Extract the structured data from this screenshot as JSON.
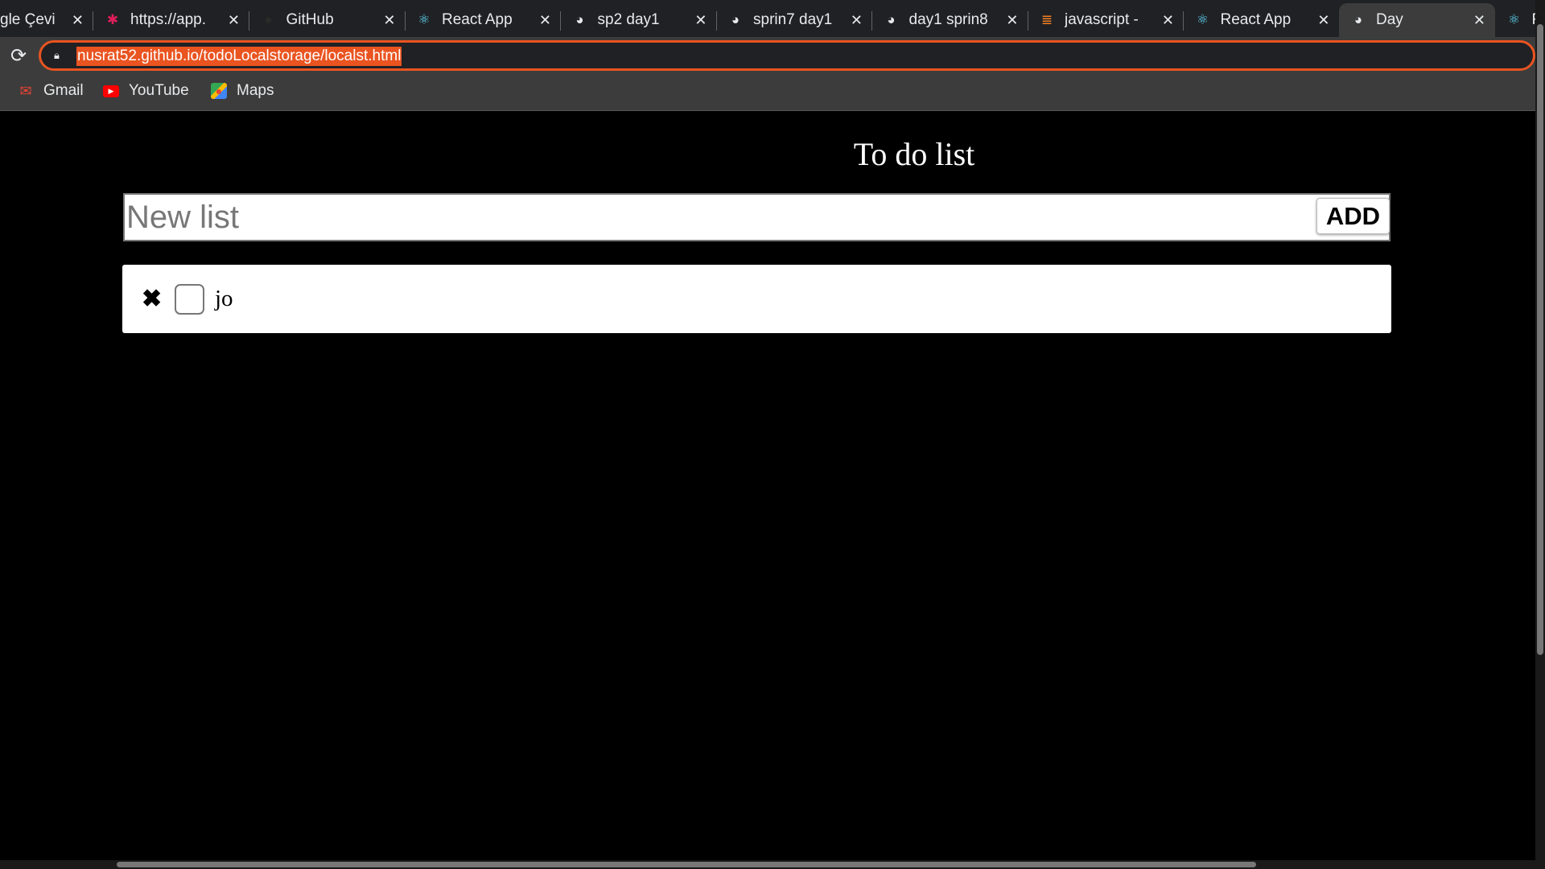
{
  "browser": {
    "tabs": [
      {
        "title": "gle Çevi",
        "icon": "google-translate-icon"
      },
      {
        "title": "https://app.",
        "icon": "slack-icon"
      },
      {
        "title": "GitHub",
        "icon": "github-icon"
      },
      {
        "title": "React App",
        "icon": "react-icon"
      },
      {
        "title": "sp2 day1",
        "icon": "globe-icon"
      },
      {
        "title": "sprin7 day1",
        "icon": "globe-icon"
      },
      {
        "title": "day1 sprin8",
        "icon": "globe-icon"
      },
      {
        "title": "javascript - ",
        "icon": "stackoverflow-icon"
      },
      {
        "title": "React App",
        "icon": "react-icon"
      },
      {
        "title": "Day",
        "icon": "globe-icon",
        "active": true
      },
      {
        "title": "R",
        "icon": "react-icon"
      }
    ],
    "url": "nusrat52.github.io/todoLocalstorage/localst.html",
    "bookmarks": [
      {
        "label": "Gmail",
        "icon": "gmail-icon"
      },
      {
        "label": "YouTube",
        "icon": "youtube-icon"
      },
      {
        "label": "Maps",
        "icon": "maps-icon"
      }
    ],
    "accent": "#e95420"
  },
  "app": {
    "title": "To do list",
    "input_placeholder": "New list",
    "input_value": "",
    "add_label": "ADD",
    "items": [
      {
        "text": "jo",
        "checked": false,
        "delete_glyph": "✖"
      }
    ]
  }
}
